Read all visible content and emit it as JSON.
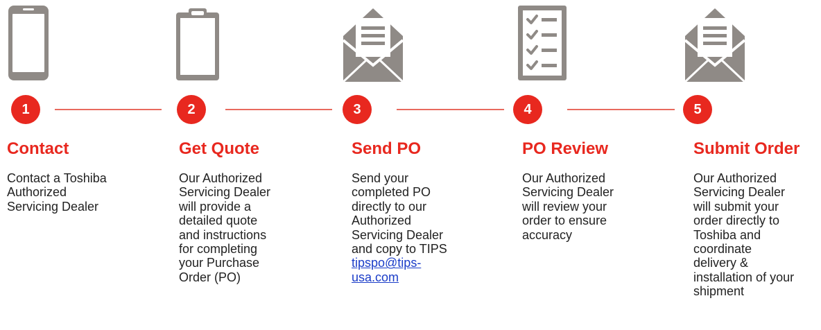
{
  "colors": {
    "accent": "#e8281f",
    "connector": "#e86a5e",
    "icon": "#8f8a86",
    "link": "#1a3cc8"
  },
  "steps": [
    {
      "number": "1",
      "icon": "smartphone-icon",
      "title": "Contact",
      "lines": [
        "Contact a Toshiba",
        "Authorized",
        "Servicing Dealer"
      ]
    },
    {
      "number": "2",
      "icon": "clipboard-icon",
      "title": "Get Quote",
      "lines": [
        "Our Authorized",
        "Servicing Dealer",
        "will provide a",
        "detailed quote",
        "and instructions",
        "for completing",
        "your Purchase",
        "Order (PO)"
      ]
    },
    {
      "number": "3",
      "icon": "open-envelope-icon",
      "title": "Send PO",
      "lines": [
        "Send your",
        "completed PO",
        "directly to our",
        "Authorized",
        "Servicing Dealer",
        "and copy to TIPS"
      ],
      "link_lines": [
        "tipspo@tips-",
        "usa.com"
      ]
    },
    {
      "number": "4",
      "icon": "checklist-icon",
      "title": "PO Review",
      "lines": [
        "Our Authorized",
        "Servicing Dealer",
        "will review your",
        "order to ensure",
        "accuracy"
      ]
    },
    {
      "number": "5",
      "icon": "open-envelope-icon",
      "title": "Submit Order",
      "lines": [
        "Our Authorized",
        "Servicing Dealer",
        "will submit your",
        "order directly to",
        "Toshiba and",
        "coordinate",
        "delivery &",
        "installation of your",
        "shipment"
      ]
    }
  ]
}
